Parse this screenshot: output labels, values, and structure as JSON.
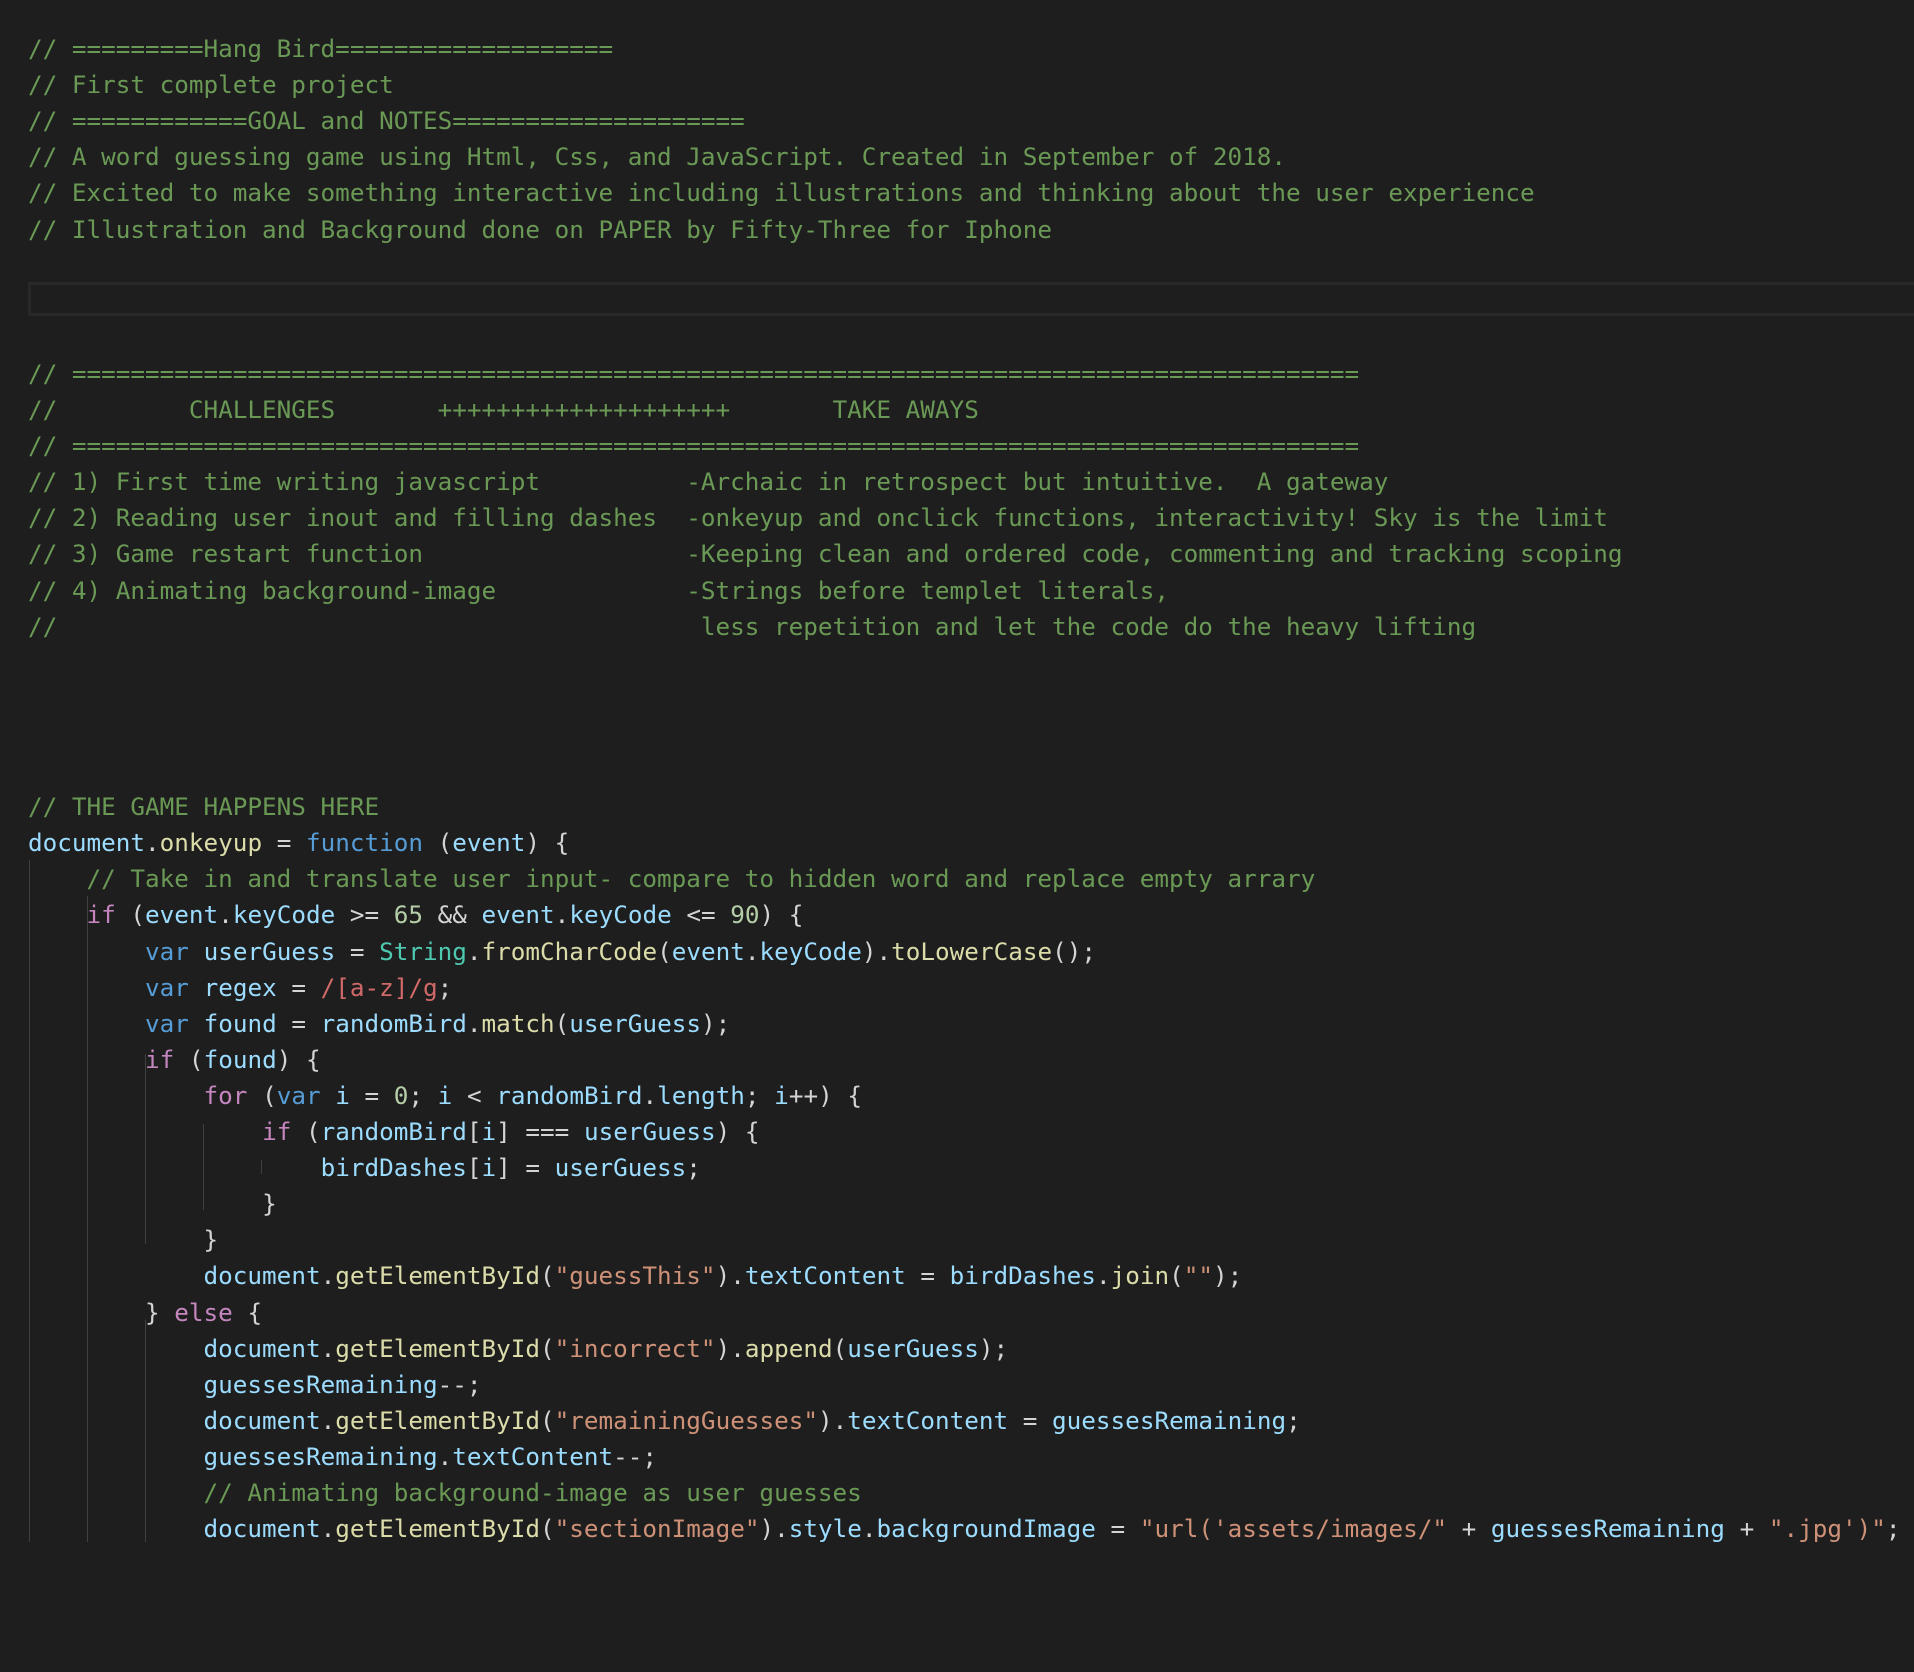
{
  "editor": {
    "background": "#1e1e1e",
    "theme_colors": {
      "comment": "#6a9955",
      "keyword": "#c586c0",
      "storage": "#569cd6",
      "variable": "#9cdcfe",
      "function": "#dcdcaa",
      "class": "#4ec9b0",
      "number": "#b5cea8",
      "string": "#ce9178",
      "regex": "#d16969",
      "punctuation": "#d4d4d4"
    },
    "lines": [
      {
        "tokens": [
          {
            "t": "comment",
            "v": "// =========Hang Bird==================="
          }
        ]
      },
      {
        "tokens": [
          {
            "t": "comment",
            "v": "// First complete project"
          }
        ]
      },
      {
        "tokens": [
          {
            "t": "comment",
            "v": "// ============GOAL and NOTES===================="
          }
        ]
      },
      {
        "tokens": [
          {
            "t": "comment",
            "v": "// A word guessing game using Html, Css, and JavaScript. Created in September of 2018."
          }
        ]
      },
      {
        "tokens": [
          {
            "t": "comment",
            "v": "// Excited to make something interactive including illustrations and thinking about the user experience"
          }
        ]
      },
      {
        "tokens": [
          {
            "t": "comment",
            "v": "// Illustration and Background done on PAPER by Fifty-Three for Iphone"
          }
        ]
      },
      {
        "tokens": []
      },
      {
        "tokens": []
      },
      {
        "tokens": []
      },
      {
        "tokens": [
          {
            "t": "comment",
            "v": "// ========================================================================================"
          }
        ]
      },
      {
        "tokens": [
          {
            "t": "comment",
            "v": "//         CHALLENGES       ++++++++++++++++++++       TAKE AWAYS"
          }
        ]
      },
      {
        "tokens": [
          {
            "t": "comment",
            "v": "// ========================================================================================"
          }
        ]
      },
      {
        "tokens": [
          {
            "t": "comment",
            "v": "// 1) First time writing javascript          -Archaic in retrospect but intuitive.  A gateway"
          }
        ]
      },
      {
        "tokens": [
          {
            "t": "comment",
            "v": "// 2) Reading user inout and filling dashes  -onkeyup and onclick functions, interactivity! Sky is the limit"
          }
        ]
      },
      {
        "tokens": [
          {
            "t": "comment",
            "v": "// 3) Game restart function                  -Keeping clean and ordered code, commenting and tracking scoping"
          }
        ]
      },
      {
        "tokens": [
          {
            "t": "comment",
            "v": "// 4) Animating background-image             -Strings before templet literals,"
          }
        ]
      },
      {
        "tokens": [
          {
            "t": "comment",
            "v": "//                                            less repetition and let the code do the heavy lifting"
          }
        ]
      },
      {
        "tokens": []
      },
      {
        "tokens": []
      },
      {
        "tokens": []
      },
      {
        "tokens": []
      },
      {
        "tokens": [
          {
            "t": "comment",
            "v": "// THE GAME HAPPENS HERE"
          }
        ]
      },
      {
        "tokens": [
          {
            "t": "variable",
            "v": "document"
          },
          {
            "t": "punct",
            "v": "."
          },
          {
            "t": "function",
            "v": "onkeyup"
          },
          {
            "t": "punct",
            "v": " = "
          },
          {
            "t": "storage",
            "v": "function"
          },
          {
            "t": "punct",
            "v": " ("
          },
          {
            "t": "variable",
            "v": "event"
          },
          {
            "t": "punct",
            "v": ") {"
          }
        ]
      },
      {
        "tokens": [
          {
            "t": "plain",
            "v": "    "
          },
          {
            "t": "comment",
            "v": "// Take in and translate user input- compare to hidden word and replace empty arrary"
          }
        ]
      },
      {
        "tokens": [
          {
            "t": "plain",
            "v": "    "
          },
          {
            "t": "keyword",
            "v": "if"
          },
          {
            "t": "punct",
            "v": " ("
          },
          {
            "t": "variable",
            "v": "event"
          },
          {
            "t": "punct",
            "v": "."
          },
          {
            "t": "variable",
            "v": "keyCode"
          },
          {
            "t": "punct",
            "v": " >= "
          },
          {
            "t": "number",
            "v": "65"
          },
          {
            "t": "punct",
            "v": " && "
          },
          {
            "t": "variable",
            "v": "event"
          },
          {
            "t": "punct",
            "v": "."
          },
          {
            "t": "variable",
            "v": "keyCode"
          },
          {
            "t": "punct",
            "v": " <= "
          },
          {
            "t": "number",
            "v": "90"
          },
          {
            "t": "punct",
            "v": ") {"
          }
        ]
      },
      {
        "tokens": [
          {
            "t": "plain",
            "v": "        "
          },
          {
            "t": "storage",
            "v": "var"
          },
          {
            "t": "plain",
            "v": " "
          },
          {
            "t": "variable",
            "v": "userGuess"
          },
          {
            "t": "punct",
            "v": " = "
          },
          {
            "t": "class",
            "v": "String"
          },
          {
            "t": "punct",
            "v": "."
          },
          {
            "t": "function",
            "v": "fromCharCode"
          },
          {
            "t": "punct",
            "v": "("
          },
          {
            "t": "variable",
            "v": "event"
          },
          {
            "t": "punct",
            "v": "."
          },
          {
            "t": "variable",
            "v": "keyCode"
          },
          {
            "t": "punct",
            "v": ")."
          },
          {
            "t": "function",
            "v": "toLowerCase"
          },
          {
            "t": "punct",
            "v": "();"
          }
        ]
      },
      {
        "tokens": [
          {
            "t": "plain",
            "v": "        "
          },
          {
            "t": "storage",
            "v": "var"
          },
          {
            "t": "plain",
            "v": " "
          },
          {
            "t": "variable",
            "v": "regex"
          },
          {
            "t": "punct",
            "v": " = "
          },
          {
            "t": "regex",
            "v": "/[a-z]/g"
          },
          {
            "t": "punct",
            "v": ";"
          }
        ]
      },
      {
        "tokens": [
          {
            "t": "plain",
            "v": "        "
          },
          {
            "t": "storage",
            "v": "var"
          },
          {
            "t": "plain",
            "v": " "
          },
          {
            "t": "variable",
            "v": "found"
          },
          {
            "t": "punct",
            "v": " = "
          },
          {
            "t": "variable",
            "v": "randomBird"
          },
          {
            "t": "punct",
            "v": "."
          },
          {
            "t": "function",
            "v": "match"
          },
          {
            "t": "punct",
            "v": "("
          },
          {
            "t": "variable",
            "v": "userGuess"
          },
          {
            "t": "punct",
            "v": ");"
          }
        ]
      },
      {
        "tokens": [
          {
            "t": "plain",
            "v": "        "
          },
          {
            "t": "keyword",
            "v": "if"
          },
          {
            "t": "punct",
            "v": " ("
          },
          {
            "t": "variable",
            "v": "found"
          },
          {
            "t": "punct",
            "v": ") {"
          }
        ]
      },
      {
        "tokens": [
          {
            "t": "plain",
            "v": "            "
          },
          {
            "t": "keyword",
            "v": "for"
          },
          {
            "t": "punct",
            "v": " ("
          },
          {
            "t": "storage",
            "v": "var"
          },
          {
            "t": "plain",
            "v": " "
          },
          {
            "t": "variable",
            "v": "i"
          },
          {
            "t": "punct",
            "v": " = "
          },
          {
            "t": "number",
            "v": "0"
          },
          {
            "t": "punct",
            "v": "; "
          },
          {
            "t": "variable",
            "v": "i"
          },
          {
            "t": "punct",
            "v": " < "
          },
          {
            "t": "variable",
            "v": "randomBird"
          },
          {
            "t": "punct",
            "v": "."
          },
          {
            "t": "variable",
            "v": "length"
          },
          {
            "t": "punct",
            "v": "; "
          },
          {
            "t": "variable",
            "v": "i"
          },
          {
            "t": "punct",
            "v": "++) {"
          }
        ]
      },
      {
        "tokens": [
          {
            "t": "plain",
            "v": "                "
          },
          {
            "t": "keyword",
            "v": "if"
          },
          {
            "t": "punct",
            "v": " ("
          },
          {
            "t": "variable",
            "v": "randomBird"
          },
          {
            "t": "punct",
            "v": "["
          },
          {
            "t": "variable",
            "v": "i"
          },
          {
            "t": "punct",
            "v": "] === "
          },
          {
            "t": "variable",
            "v": "userGuess"
          },
          {
            "t": "punct",
            "v": ") {"
          }
        ]
      },
      {
        "tokens": [
          {
            "t": "plain",
            "v": "                    "
          },
          {
            "t": "variable",
            "v": "birdDashes"
          },
          {
            "t": "punct",
            "v": "["
          },
          {
            "t": "variable",
            "v": "i"
          },
          {
            "t": "punct",
            "v": "] = "
          },
          {
            "t": "variable",
            "v": "userGuess"
          },
          {
            "t": "punct",
            "v": ";"
          }
        ]
      },
      {
        "tokens": [
          {
            "t": "plain",
            "v": "                "
          },
          {
            "t": "punct",
            "v": "}"
          }
        ]
      },
      {
        "tokens": [
          {
            "t": "plain",
            "v": "            "
          },
          {
            "t": "punct",
            "v": "}"
          }
        ]
      },
      {
        "tokens": [
          {
            "t": "plain",
            "v": "            "
          },
          {
            "t": "variable",
            "v": "document"
          },
          {
            "t": "punct",
            "v": "."
          },
          {
            "t": "function",
            "v": "getElementById"
          },
          {
            "t": "punct",
            "v": "("
          },
          {
            "t": "string",
            "v": "\"guessThis\""
          },
          {
            "t": "punct",
            "v": ")."
          },
          {
            "t": "variable",
            "v": "textContent"
          },
          {
            "t": "punct",
            "v": " = "
          },
          {
            "t": "variable",
            "v": "birdDashes"
          },
          {
            "t": "punct",
            "v": "."
          },
          {
            "t": "function",
            "v": "join"
          },
          {
            "t": "punct",
            "v": "("
          },
          {
            "t": "string",
            "v": "\"\""
          },
          {
            "t": "punct",
            "v": ");"
          }
        ]
      },
      {
        "tokens": [
          {
            "t": "plain",
            "v": "        "
          },
          {
            "t": "punct",
            "v": "} "
          },
          {
            "t": "keyword",
            "v": "else"
          },
          {
            "t": "punct",
            "v": " {"
          }
        ]
      },
      {
        "tokens": [
          {
            "t": "plain",
            "v": "            "
          },
          {
            "t": "variable",
            "v": "document"
          },
          {
            "t": "punct",
            "v": "."
          },
          {
            "t": "function",
            "v": "getElementById"
          },
          {
            "t": "punct",
            "v": "("
          },
          {
            "t": "string",
            "v": "\"incorrect\""
          },
          {
            "t": "punct",
            "v": ")."
          },
          {
            "t": "function",
            "v": "append"
          },
          {
            "t": "punct",
            "v": "("
          },
          {
            "t": "variable",
            "v": "userGuess"
          },
          {
            "t": "punct",
            "v": ");"
          }
        ]
      },
      {
        "tokens": [
          {
            "t": "plain",
            "v": "            "
          },
          {
            "t": "variable",
            "v": "guessesRemaining"
          },
          {
            "t": "punct",
            "v": "--;"
          }
        ]
      },
      {
        "tokens": [
          {
            "t": "plain",
            "v": "            "
          },
          {
            "t": "variable",
            "v": "document"
          },
          {
            "t": "punct",
            "v": "."
          },
          {
            "t": "function",
            "v": "getElementById"
          },
          {
            "t": "punct",
            "v": "("
          },
          {
            "t": "string",
            "v": "\"remainingGuesses\""
          },
          {
            "t": "punct",
            "v": ")."
          },
          {
            "t": "variable",
            "v": "textContent"
          },
          {
            "t": "punct",
            "v": " = "
          },
          {
            "t": "variable",
            "v": "guessesRemaining"
          },
          {
            "t": "punct",
            "v": ";"
          }
        ]
      },
      {
        "tokens": [
          {
            "t": "plain",
            "v": "            "
          },
          {
            "t": "variable",
            "v": "guessesRemaining"
          },
          {
            "t": "punct",
            "v": "."
          },
          {
            "t": "variable",
            "v": "textContent"
          },
          {
            "t": "punct",
            "v": "--;"
          }
        ]
      },
      {
        "tokens": [
          {
            "t": "plain",
            "v": "            "
          },
          {
            "t": "comment",
            "v": "// Animating background-image as user guesses"
          }
        ]
      },
      {
        "tokens": [
          {
            "t": "plain",
            "v": "            "
          },
          {
            "t": "variable",
            "v": "document"
          },
          {
            "t": "punct",
            "v": "."
          },
          {
            "t": "function",
            "v": "getElementById"
          },
          {
            "t": "punct",
            "v": "("
          },
          {
            "t": "string",
            "v": "\"sectionImage\""
          },
          {
            "t": "punct",
            "v": ")."
          },
          {
            "t": "variable",
            "v": "style"
          },
          {
            "t": "punct",
            "v": "."
          },
          {
            "t": "variable",
            "v": "backgroundImage"
          },
          {
            "t": "punct",
            "v": " = "
          },
          {
            "t": "string",
            "v": "\"url('assets/images/\""
          },
          {
            "t": "punct",
            "v": " + "
          },
          {
            "t": "variable",
            "v": "guessesRemaining"
          },
          {
            "t": "punct",
            "v": " + "
          },
          {
            "t": "string",
            "v": "\".jpg')\""
          },
          {
            "t": "punct",
            "v": ";"
          }
        ]
      }
    ]
  }
}
